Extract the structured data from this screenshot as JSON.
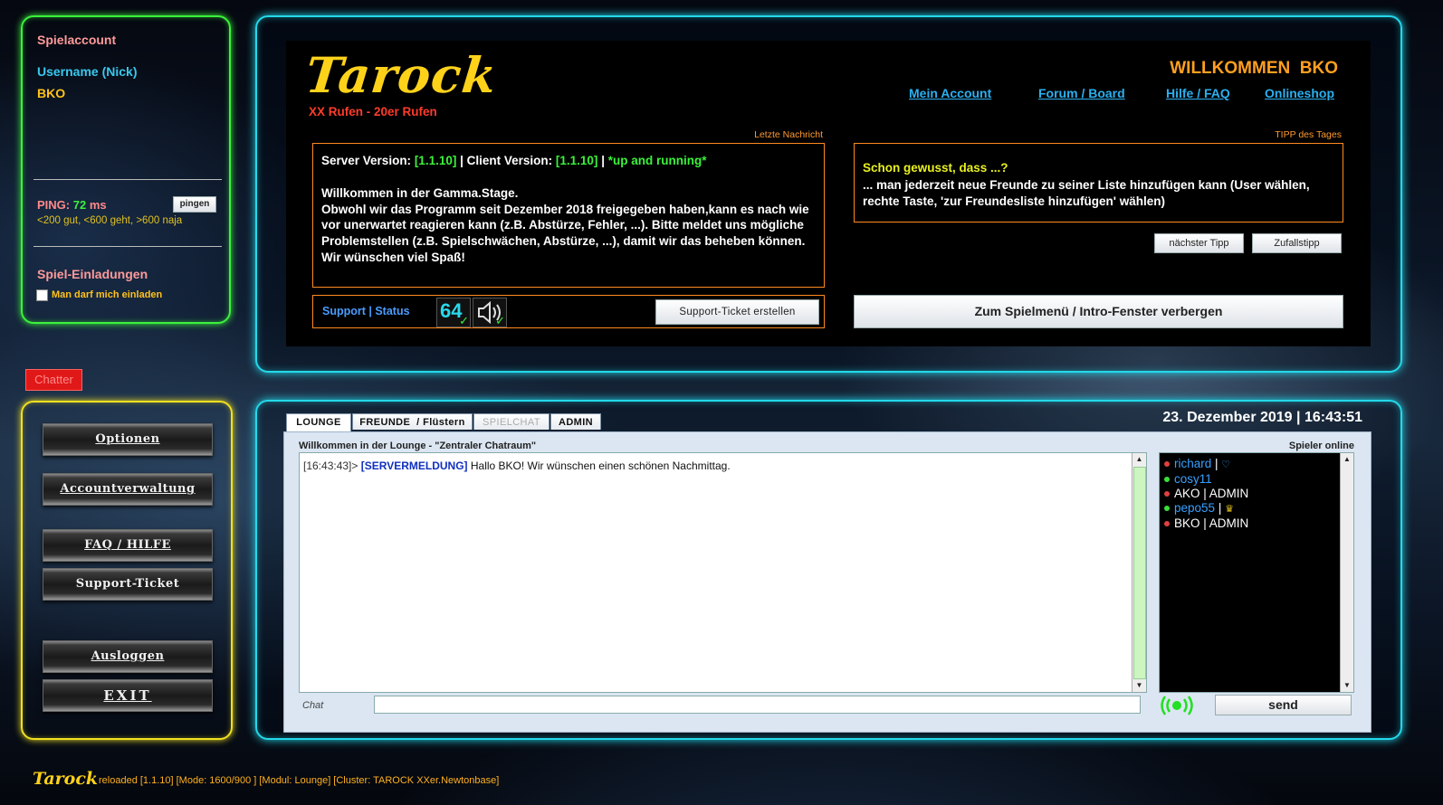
{
  "account": {
    "heading": "Spielaccount",
    "username_label": "Username (Nick)",
    "username": "BKO",
    "ping_label": "PING:",
    "ping_value": "72",
    "ping_unit": "ms",
    "ping_button": "pingen",
    "ping_legend": "<200 gut, <600 geht, >600 naja",
    "invites_heading": "Spiel-Einladungen",
    "invites_checkbox": "Man darf mich einladen"
  },
  "chatter_badge": "Chatter",
  "menu": {
    "items": [
      "Optionen",
      "Accountverwaltung",
      "FAQ / HILFE",
      "Support-Ticket",
      "Ausloggen",
      "EXIT"
    ]
  },
  "header": {
    "logo": "Tarock",
    "subtitle": "XX Rufen - 20er Rufen",
    "welcome": "WILLKOMMEN  BKO",
    "nav": [
      "Mein Account",
      "Forum / Board",
      "Hilfe / FAQ",
      "Onlineshop"
    ]
  },
  "news": {
    "label": "Letzte Nachricht",
    "server_label": "Server Version: ",
    "server_version": "[1.1.10]",
    "client_label": " | Client Version: ",
    "client_version": "[1.1.10]",
    "sep": " | ",
    "status_text": "*up and running*",
    "welcome_line": "Willkommen in der Gamma.Stage.",
    "body": "Obwohl wir das Programm seit Dezember 2018 freigegeben haben,kann es nach wie vor unerwartet reagieren kann (z.B. Abstürze, Fehler, ...). Bitte meldet uns mögliche Problemstellen (z.B. Spielschwächen, Abstürze, ...), damit wir das beheben können. Wir wünschen viel Spaß!"
  },
  "support": {
    "label": "Support | Status",
    "badge_64": "64",
    "ticket_button": "Support-Ticket erstellen"
  },
  "tip": {
    "label": "TIPP des Tages",
    "title": "Schon gewusst, dass ...?",
    "text": "... man jederzeit neue Freunde zu seiner Liste hinzufügen kann (User wählen, rechte Taste, 'zur Freundesliste hinzufügen' wählen)",
    "next_button": "nächster Tipp",
    "random_button": "Zufallstipp"
  },
  "hide_button": "Zum Spielmenü / Intro-Fenster verbergen",
  "chat": {
    "datetime": "23. Dezember 2019 | 16:43:51",
    "tabs": [
      "LOUNGE",
      "FREUNDE  / Flüstern",
      "SPIELCHAT",
      "ADMIN"
    ],
    "room_title": "Willkommen in der Lounge - \"Zentraler Chatraum\"",
    "players_title": "Spieler online",
    "messages": [
      {
        "time": "[16:43:43]>",
        "tag": "[SERVERMELDUNG]",
        "text": " Hallo BKO! Wir wünschen einen schönen Nachmittag."
      }
    ],
    "players": [
      {
        "name": "richard",
        "suffix": " | ",
        "extra": "♡",
        "dot": "#e04040",
        "color": "#3aa0ff"
      },
      {
        "name": "cosy11",
        "suffix": "",
        "extra": "",
        "dot": "#3adf3a",
        "color": "#3aa0ff"
      },
      {
        "name": "AKO | ADMIN",
        "suffix": "",
        "extra": "",
        "dot": "#e04040",
        "color": "#ffffff"
      },
      {
        "name": "pepo55",
        "suffix": " | ",
        "extra": "♛",
        "dot": "#3adf3a",
        "color": "#3aa0ff"
      },
      {
        "name": "BKO | ADMIN",
        "suffix": "",
        "extra": "",
        "dot": "#e04040",
        "color": "#ffffff"
      }
    ],
    "input_label": "Chat",
    "input_value": "",
    "send_button": "send"
  },
  "footer": {
    "logo": "Tarock",
    "text": "reloaded [1.1.10] [Mode: 1600/900 ] [Modul: Lounge] [Cluster: TAROCK XXer.Newtonbase]"
  }
}
